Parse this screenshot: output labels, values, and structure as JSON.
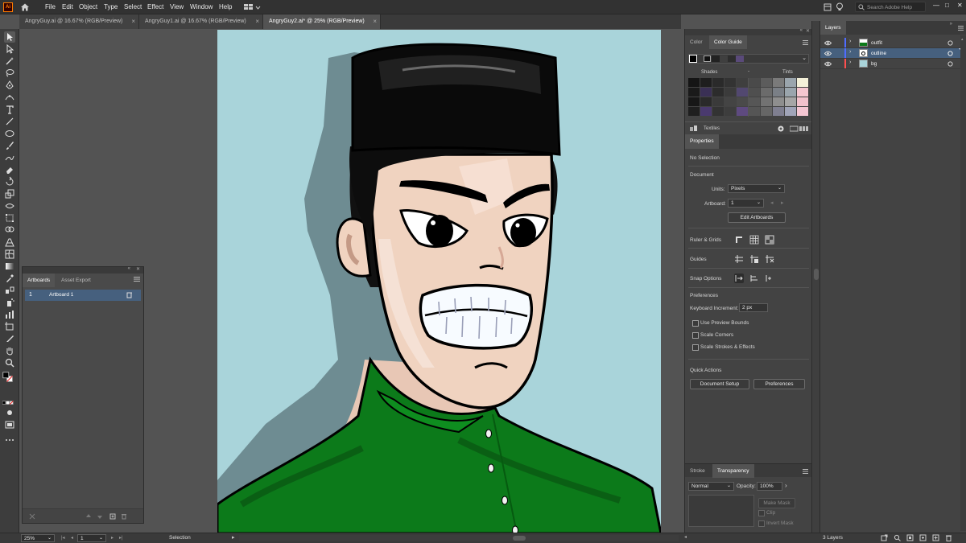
{
  "app": {
    "logo": "Ai",
    "help_search_placeholder": "Search Adobe Help"
  },
  "menu": [
    "File",
    "Edit",
    "Object",
    "Type",
    "Select",
    "Effect",
    "View",
    "Window",
    "Help"
  ],
  "doc_tabs": [
    {
      "label": "AngryGuy.ai @ 16.67% (RGB/Preview)",
      "close": "×"
    },
    {
      "label": "AngryGuy1.ai @ 16.67% (RGB/Preview)",
      "close": "×"
    },
    {
      "label": "AngryGuy2.ai* @ 25% (RGB/Preview)",
      "close": "×"
    }
  ],
  "artboards_panel": {
    "tabs": [
      "Artboards",
      "Asset Export"
    ],
    "rows": [
      {
        "num": "1",
        "name": "Artboard 1"
      }
    ]
  },
  "color_panel": {
    "tabs": [
      "Color",
      "Color Guide"
    ],
    "shades_label": "Shades",
    "tints_label": "Tints",
    "footer_label": "Textiles",
    "swatch_colors": [
      "#222222",
      "#3f3f3f",
      "#4a4a4a",
      "#2d2d2d",
      "#5a4a7a"
    ]
  },
  "properties": {
    "title": "Properties",
    "selection": "No Selection",
    "document_label": "Document",
    "units_label": "Units:",
    "units_value": "Pixels",
    "artboard_label": "Artboard:",
    "artboard_value": "1",
    "edit_artboards": "Edit Artboards",
    "ruler_grids": "Ruler & Grids",
    "guides": "Guides",
    "snap_options": "Snap Options",
    "preferences_label": "Preferences",
    "keyboard_increment_label": "Keyboard Increment:",
    "keyboard_increment_value": "2 px",
    "use_preview_bounds": "Use Preview Bounds",
    "scale_corners": "Scale Corners",
    "scale_strokes": "Scale Strokes & Effects",
    "quick_actions": "Quick Actions",
    "document_setup": "Document Setup",
    "preferences_button": "Preferences"
  },
  "transparency": {
    "tabs": [
      "Stroke",
      "Transparency"
    ],
    "blend_mode": "Normal",
    "opacity_label": "Opacity:",
    "opacity_value": "100%",
    "make_mask": "Make Mask",
    "clip": "Clip",
    "invert_mask": "Invert Mask"
  },
  "layers": {
    "title": "Layers",
    "items": [
      {
        "name": "outfit",
        "color": "#4f6cff"
      },
      {
        "name": "outline",
        "color": "#4f6cff"
      },
      {
        "name": "bg",
        "color": "#ff4f4f"
      }
    ],
    "count": "3 Layers"
  },
  "status": {
    "zoom": "25%",
    "artboard_num": "1",
    "tool": "Selection"
  },
  "artwork_colors": {
    "background": "#a9d4da",
    "shadow": "#6e8c92",
    "skin": "#f0d3c0",
    "hat": "#0a0a0a",
    "shirt": "#0c7a1a"
  }
}
